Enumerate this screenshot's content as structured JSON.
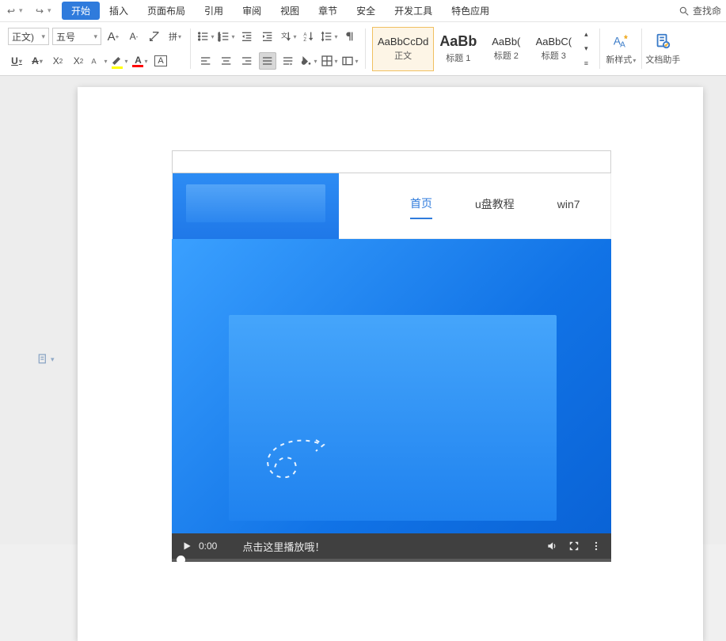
{
  "menu": {
    "tabs": [
      "开始",
      "插入",
      "页面布局",
      "引用",
      "审阅",
      "视图",
      "章节",
      "安全",
      "开发工具",
      "特色应用"
    ],
    "active_index": 0,
    "search_placeholder": "查找命"
  },
  "ribbon": {
    "font_name": "正文)",
    "font_size": "五号",
    "styles": [
      {
        "sample": "AaBbCcDd",
        "label": "正文",
        "big": false,
        "selected": true
      },
      {
        "sample": "AaBb",
        "label": "标题 1",
        "big": true,
        "selected": false
      },
      {
        "sample": "AaBb(",
        "label": "标题 2",
        "big": false,
        "selected": false
      },
      {
        "sample": "AaBbC(",
        "label": "标题 3",
        "big": false,
        "selected": false
      }
    ],
    "new_style_label": "新样式",
    "assistant_label": "文档助手",
    "colors": {
      "highlight": "#ffff00",
      "font": "#ff0000",
      "border": "#2f7bdc"
    }
  },
  "embedded": {
    "nav": [
      {
        "label": "首页",
        "active": true
      },
      {
        "label": "u盘教程",
        "active": false
      },
      {
        "label": "win7",
        "active": false
      }
    ],
    "video": {
      "time": "0:00",
      "tip": "点击这里播放哦！"
    }
  }
}
